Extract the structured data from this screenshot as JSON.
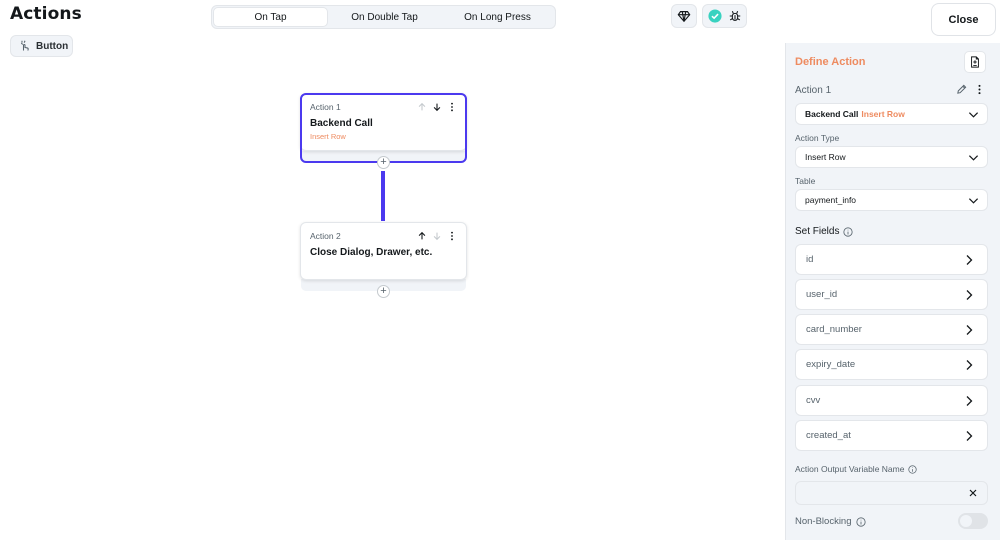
{
  "header": {
    "title": "Actions",
    "widget_chip": "Button",
    "tabs": [
      "On Tap",
      "On Double Tap",
      "On Long Press"
    ],
    "active_tab": "On Tap",
    "close_label": "Close"
  },
  "flow": {
    "actions": [
      {
        "label": "Action 1",
        "title": "Backend Call",
        "subtitle": "Insert Row"
      },
      {
        "label": "Action 2",
        "title": "Close Dialog, Drawer, etc.",
        "subtitle": ""
      }
    ],
    "add_symbol": "+"
  },
  "panel": {
    "title": "Define Action",
    "action_name": "Action 1",
    "action_dropdown": {
      "main": "Backend Call",
      "accent": "Insert Row"
    },
    "action_type_label": "Action Type",
    "action_type_value": "Insert Row",
    "table_label": "Table",
    "table_value": "payment_info",
    "set_fields_label": "Set Fields",
    "fields": [
      "id",
      "user_id",
      "card_number",
      "expiry_date",
      "cvv",
      "created_at"
    ],
    "output_var_label": "Action Output Variable Name",
    "output_var_value": "",
    "non_blocking_label": "Non-Blocking",
    "non_blocking_on": false
  },
  "colors": {
    "accent": "#4b39ef",
    "secondary": "#ee8b60",
    "success": "#39d2c0",
    "background_alt": "#f1f4f8"
  }
}
